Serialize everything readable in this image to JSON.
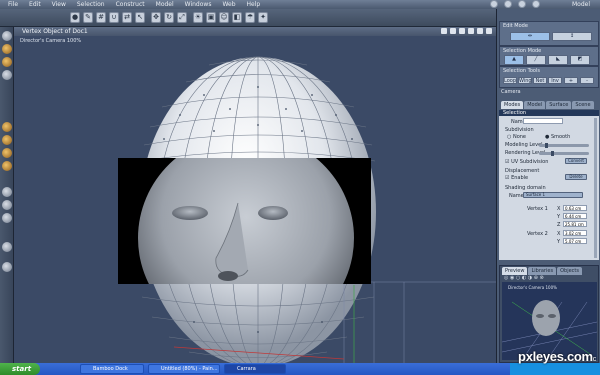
{
  "menu": {
    "items": [
      "File",
      "Edit",
      "View",
      "Selection",
      "Construct",
      "Model",
      "Windows",
      "Web",
      "Help"
    ],
    "mode_label": "Model"
  },
  "viewport": {
    "title": "Vertex Object of Doc1",
    "camera_label": "Director's Camera 100%"
  },
  "panel": {
    "edit_mode": "Edit Mode",
    "selection_mode": "Selection Mode",
    "selection_tools": "Selection Tools",
    "tool_buttons": [
      "Loop",
      "Wing",
      "Net",
      "Inv",
      "+",
      "-"
    ],
    "camera": "Camera",
    "tabs": [
      "Modes",
      "Model",
      "Surface",
      "Scene"
    ],
    "section": "Selection",
    "name_label": "Name",
    "subdivision": "Subdivision",
    "none_label": "None",
    "smooth_label": "Smooth",
    "modeling_level": "Modeling Level",
    "rendering_level": "Rendering Level",
    "uv_subdivision": "UV Subdivision",
    "convert_label": "Convert",
    "displacement": "Displacement",
    "enable_label": "Enable",
    "delete_label": "Delete",
    "shading_domain": "Shading domain",
    "shading_name_label": "Name",
    "shading_name_value": "Surface 1",
    "vertex1": "Vertex 1",
    "vertex1_x": "0.63 cm",
    "vertex1_y": "6.44 cm",
    "vertex1_z": "25.81 cm",
    "vertex2": "Vertex 2",
    "vertex2_x": "3.02 cm",
    "vertex2_y": "5.07 cm",
    "preview_tabs": [
      "Preview",
      "Libraries",
      "Objects"
    ],
    "preview_camera": "Director's Camera 100%"
  },
  "taskbar": {
    "start": "start",
    "tasks": [
      "Bamboo Dock",
      "Untitled (80%) - Pain...",
      "Carrara"
    ]
  },
  "watermark": {
    "text": "pxleyes.com",
    "sub": "c"
  }
}
